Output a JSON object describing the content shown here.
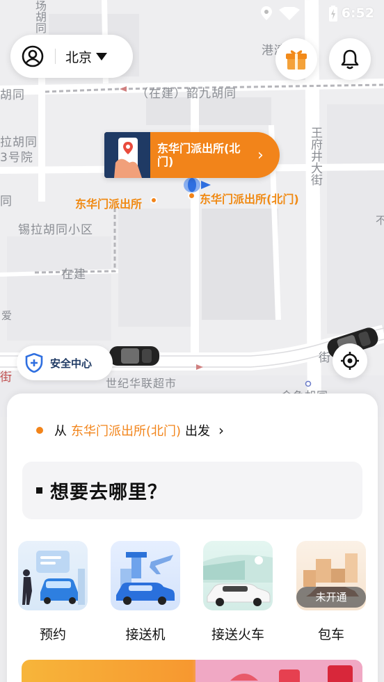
{
  "status_bar": {
    "time": "6:52"
  },
  "map": {
    "labels": {
      "gangwan": "港湾",
      "chang": "场胡同",
      "hutong_left": "胡同",
      "lala": "拉胡同",
      "no3": "3号院",
      "tong": "同",
      "xila": "锡拉胡同小区",
      "zaijian_1": "（在建）韶九胡同",
      "zaijian_2": "在建",
      "wangfujing": "王府井大街",
      "street": "街",
      "jie2": "街",
      "shiji": "世纪华联超市",
      "jinyu": "金鱼胡同",
      "ai": "爱",
      "right_edge": "不"
    },
    "poi_left": "东华门派出所",
    "poi_right": "东华门派出所(北门)"
  },
  "header": {
    "city": "北京"
  },
  "pickup_bubble": {
    "text": "东华门派出所(北门)"
  },
  "safety": {
    "label": "安全中心"
  },
  "sheet": {
    "from_prefix": "从",
    "from_place": "东华门派出所(北门)",
    "from_suffix": "出发",
    "destination_placeholder": "想要去哪里？",
    "services": [
      {
        "name": "预约"
      },
      {
        "name": "接送机"
      },
      {
        "name": "接送火车"
      },
      {
        "name": "包车",
        "badge": "未开通"
      }
    ]
  },
  "colors": {
    "accent": "#f2841a",
    "navy": "#1f3a64",
    "route": "#2f6fe0"
  }
}
